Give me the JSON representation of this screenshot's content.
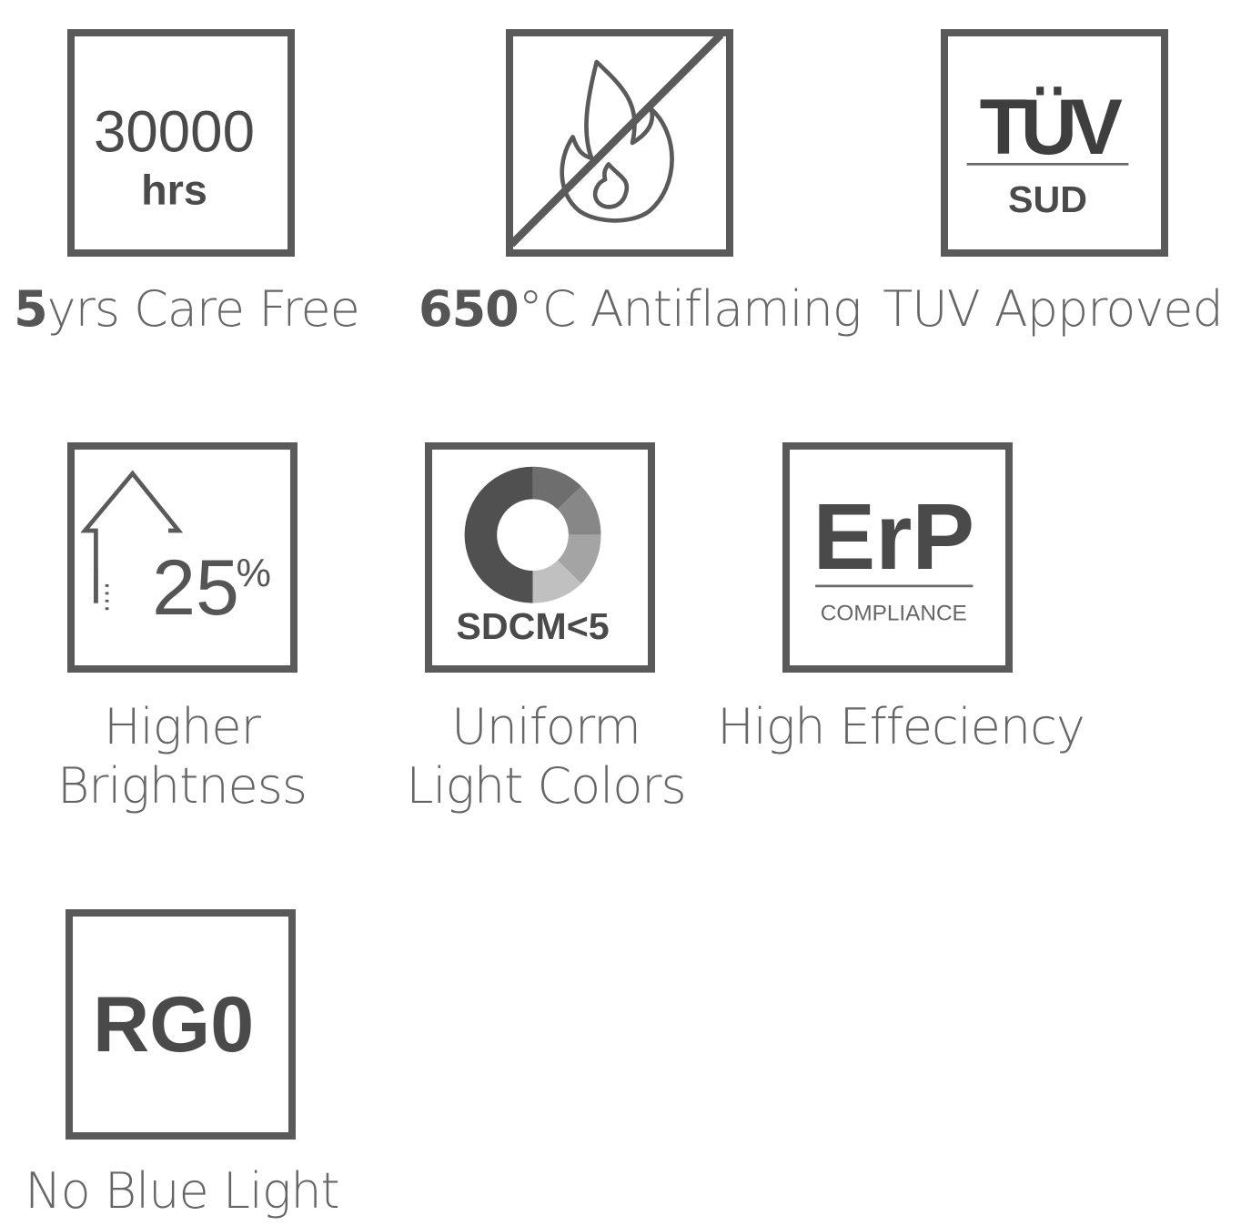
{
  "icons": [
    {
      "name": "lifetime",
      "big": "30000",
      "small": "hrs",
      "caption_bold": "5",
      "caption_rest": "yrs Care Free"
    },
    {
      "name": "antiflaming",
      "caption_bold": "650",
      "caption_rest": "°C Antiflaming"
    },
    {
      "name": "tuv",
      "big": "TÜV",
      "small": "SUD",
      "caption": "TUV Approved"
    },
    {
      "name": "brightness",
      "big": "25",
      "small": "%",
      "caption_line1": "Higher",
      "caption_line2": "Brightness"
    },
    {
      "name": "sdcm",
      "label": "SDCM<5",
      "caption_line1": "Uniform",
      "caption_line2": "Light Colors"
    },
    {
      "name": "erp",
      "big": "ErP",
      "small": "COMPLIANCE",
      "caption": "High Effeciency"
    },
    {
      "name": "rg0",
      "big": "RG0",
      "caption": "No Blue Light"
    }
  ],
  "colors": {
    "border": "#5a5a5a",
    "text": "#555555"
  }
}
